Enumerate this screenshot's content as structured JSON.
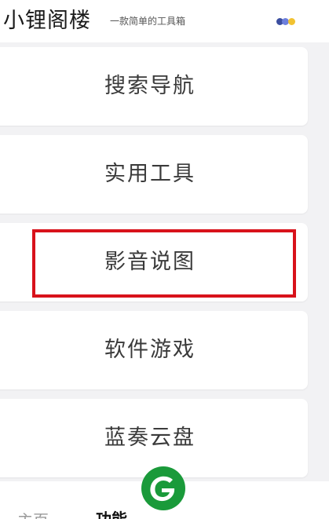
{
  "header": {
    "title": "小锂阁楼",
    "subtitle": "一款简单的工具箱",
    "menu_icon": "more-dots-icon"
  },
  "cards": [
    {
      "label": "搜索导航"
    },
    {
      "label": "实用工具"
    },
    {
      "label": "影音说图"
    },
    {
      "label": "软件游戏"
    },
    {
      "label": "蓝奏云盘"
    }
  ],
  "bottom_nav": {
    "tabs": [
      {
        "label": "主页",
        "active": false
      },
      {
        "label": "功能",
        "active": true
      }
    ],
    "fab_icon": "app-logo-icon"
  },
  "colors": {
    "accent_green": "#1a9a3a",
    "highlight_red": "#d8121b",
    "dot_dark_blue": "#3b4ea0",
    "dot_light_blue": "#6d7fdc",
    "dot_yellow": "#f2c230"
  }
}
